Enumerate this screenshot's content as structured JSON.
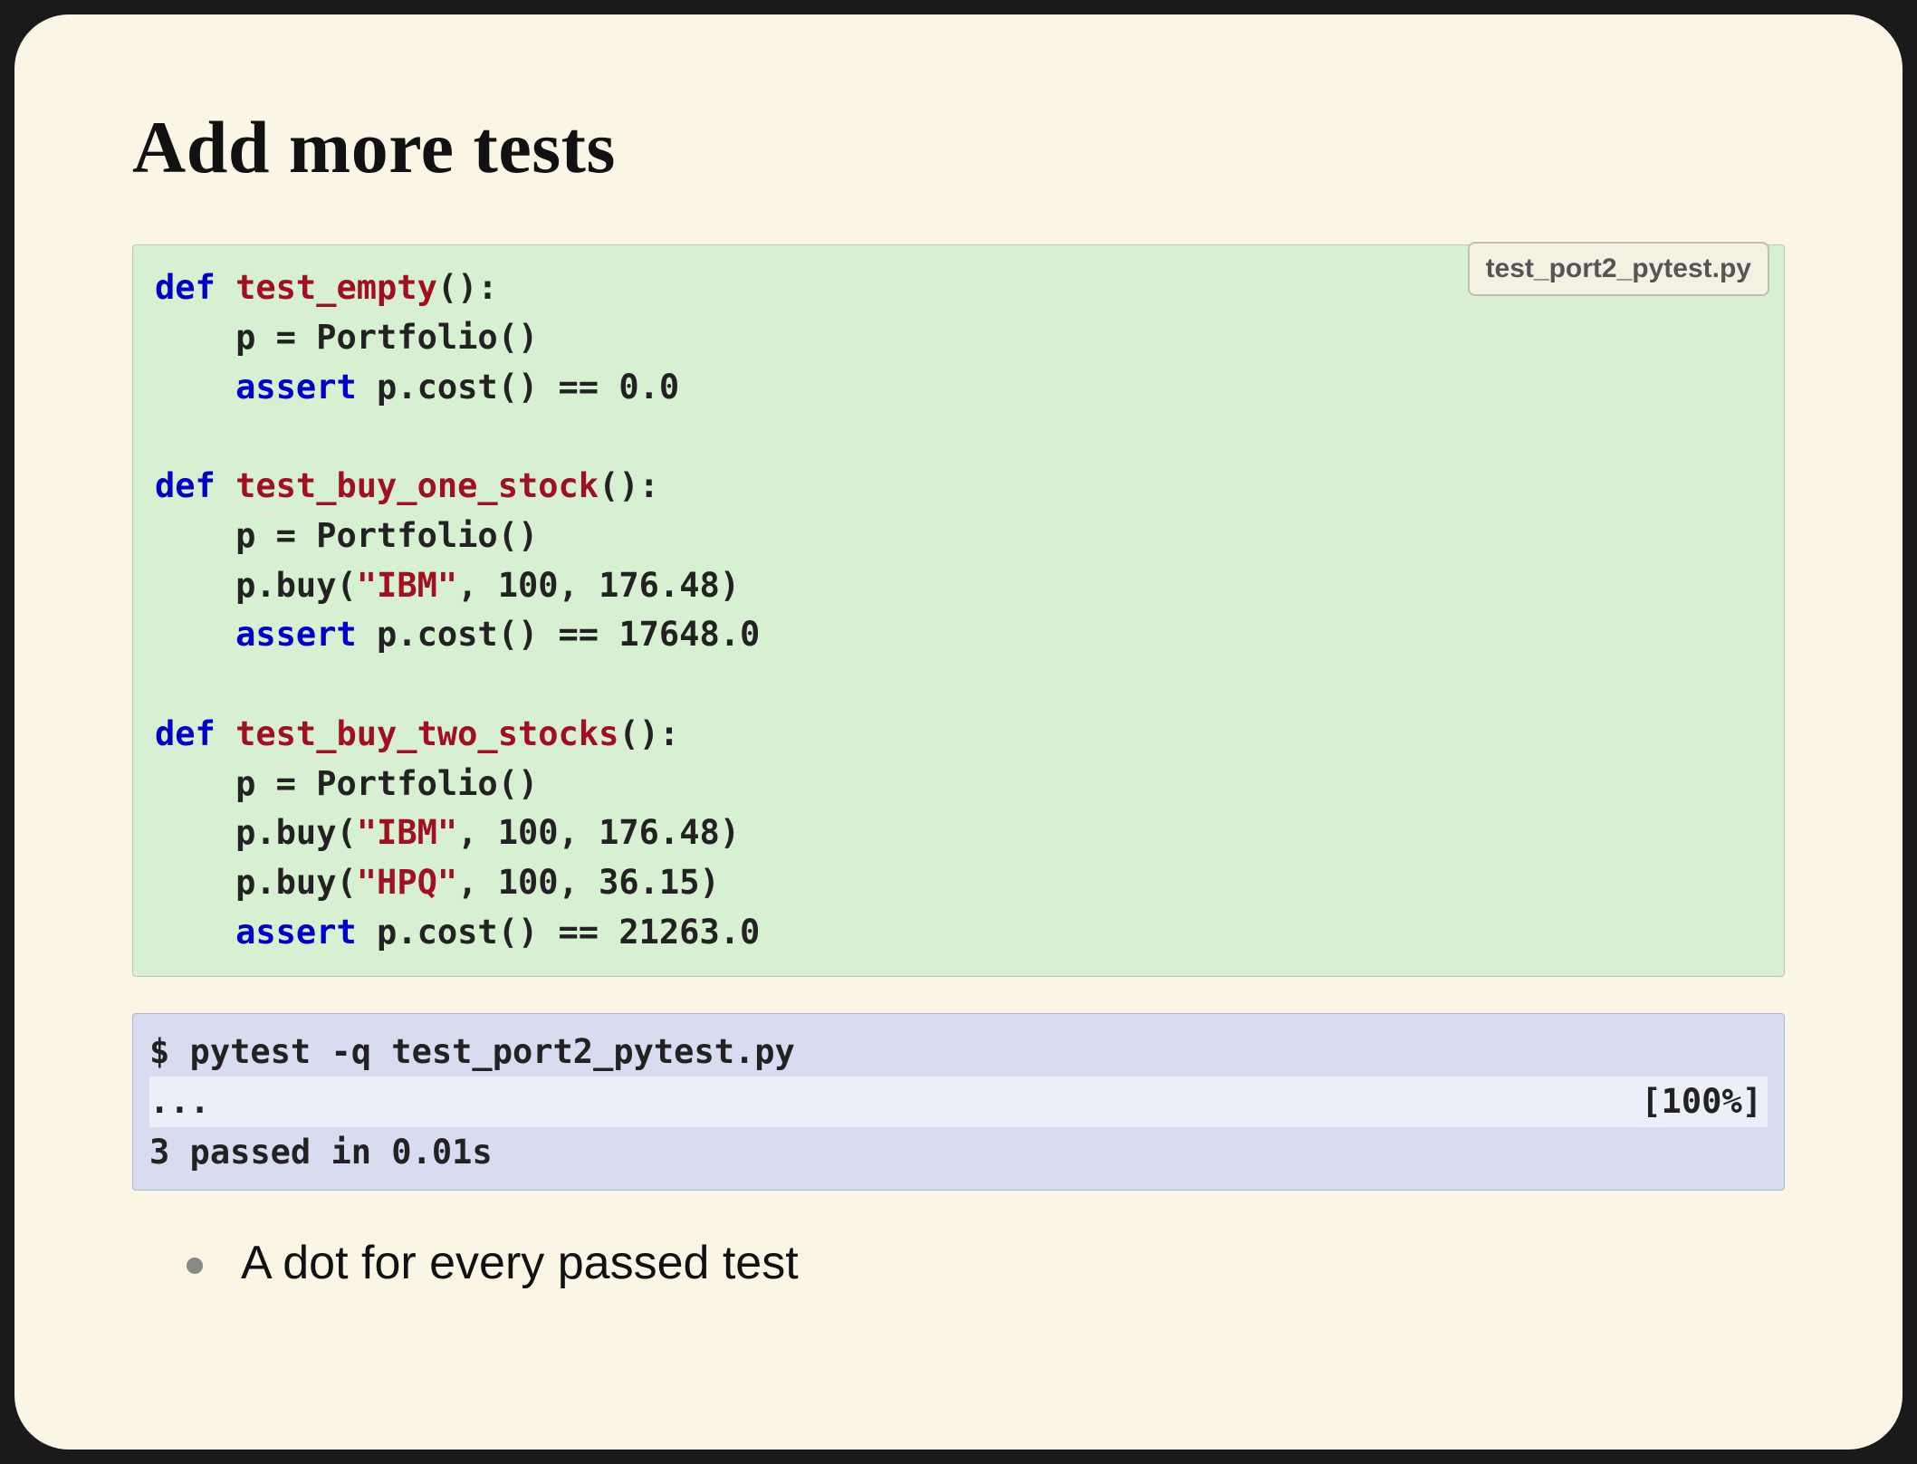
{
  "title": "Add more tests",
  "code": {
    "filename": "test_port2_pytest.py",
    "l1_def": "def",
    "l1_name": " test_empty",
    "l1_rest": "():",
    "l2": "    p = Portfolio()",
    "l3_assert": "    assert",
    "l3_rest": " p.cost() == 0.0",
    "l4": "",
    "l5_def": "def",
    "l5_name": " test_buy_one_stock",
    "l5_rest": "():",
    "l6": "    p = Portfolio()",
    "l7_a": "    p.buy(",
    "l7_str": "\"IBM\"",
    "l7_b": ", 100, 176.48)",
    "l8_assert": "    assert",
    "l8_rest": " p.cost() == 17648.0",
    "l9": "",
    "l10_def": "def",
    "l10_name": " test_buy_two_stocks",
    "l10_rest": "():",
    "l11": "    p = Portfolio()",
    "l12_a": "    p.buy(",
    "l12_str": "\"IBM\"",
    "l12_b": ", 100, 176.48)",
    "l13_a": "    p.buy(",
    "l13_str": "\"HPQ\"",
    "l13_b": ", 100, 36.15)",
    "l14_assert": "    assert",
    "l14_rest": " p.cost() == 21263.0"
  },
  "terminal": {
    "cmd": "$ pytest -q test_port2_pytest.py",
    "progress_left": "...",
    "progress_right": "[100%]",
    "result": "3 passed in 0.01s"
  },
  "bullet": "A dot for every passed test"
}
